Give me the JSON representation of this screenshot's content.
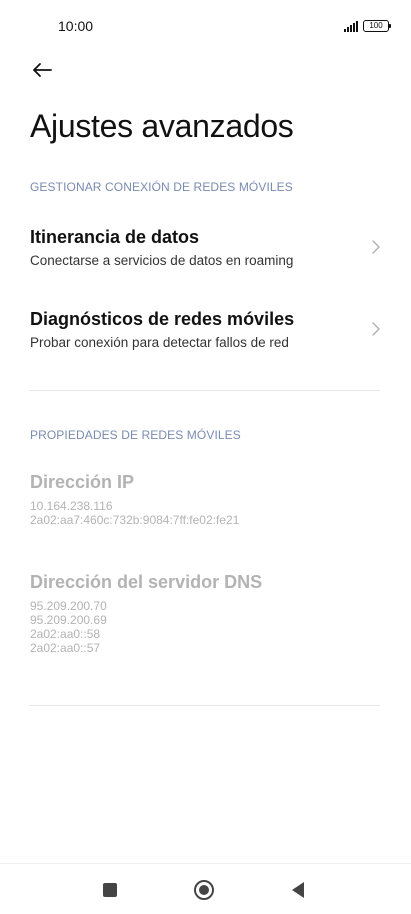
{
  "status_bar": {
    "time": "10:00",
    "battery": "100"
  },
  "header": {
    "back_icon": "arrow-left-icon",
    "title": "Ajustes avanzados"
  },
  "sections": {
    "manage": {
      "header": "GESTIONAR CONEXIÓN DE REDES MÓVILES",
      "items": [
        {
          "title": "Itinerancia de datos",
          "subtitle": "Conectarse a servicios de datos en roaming"
        },
        {
          "title": "Diagnósticos de redes móviles",
          "subtitle": "Probar conexión para detectar fallos de red"
        }
      ]
    },
    "properties": {
      "header": "PROPIEDADES DE REDES MÓVILES",
      "ip": {
        "title": "Dirección IP",
        "values": [
          "10.164.238.116",
          "2a02:aa7:460c:732b:9084:7ff:fe02:fe21"
        ]
      },
      "dns": {
        "title": "Dirección del servidor DNS",
        "values": [
          "95.209.200.70",
          "95.209.200.69",
          "2a02:aa0::58",
          "2a02:aa0::57"
        ]
      }
    }
  },
  "nav_bar": {
    "recents_icon": "square-icon",
    "home_icon": "circle-icon",
    "back_icon": "triangle-back-icon"
  },
  "colors": {
    "section_header": "#7a8bb0",
    "disabled_text": "#b3b3b3",
    "nav_icon": "#444444"
  }
}
